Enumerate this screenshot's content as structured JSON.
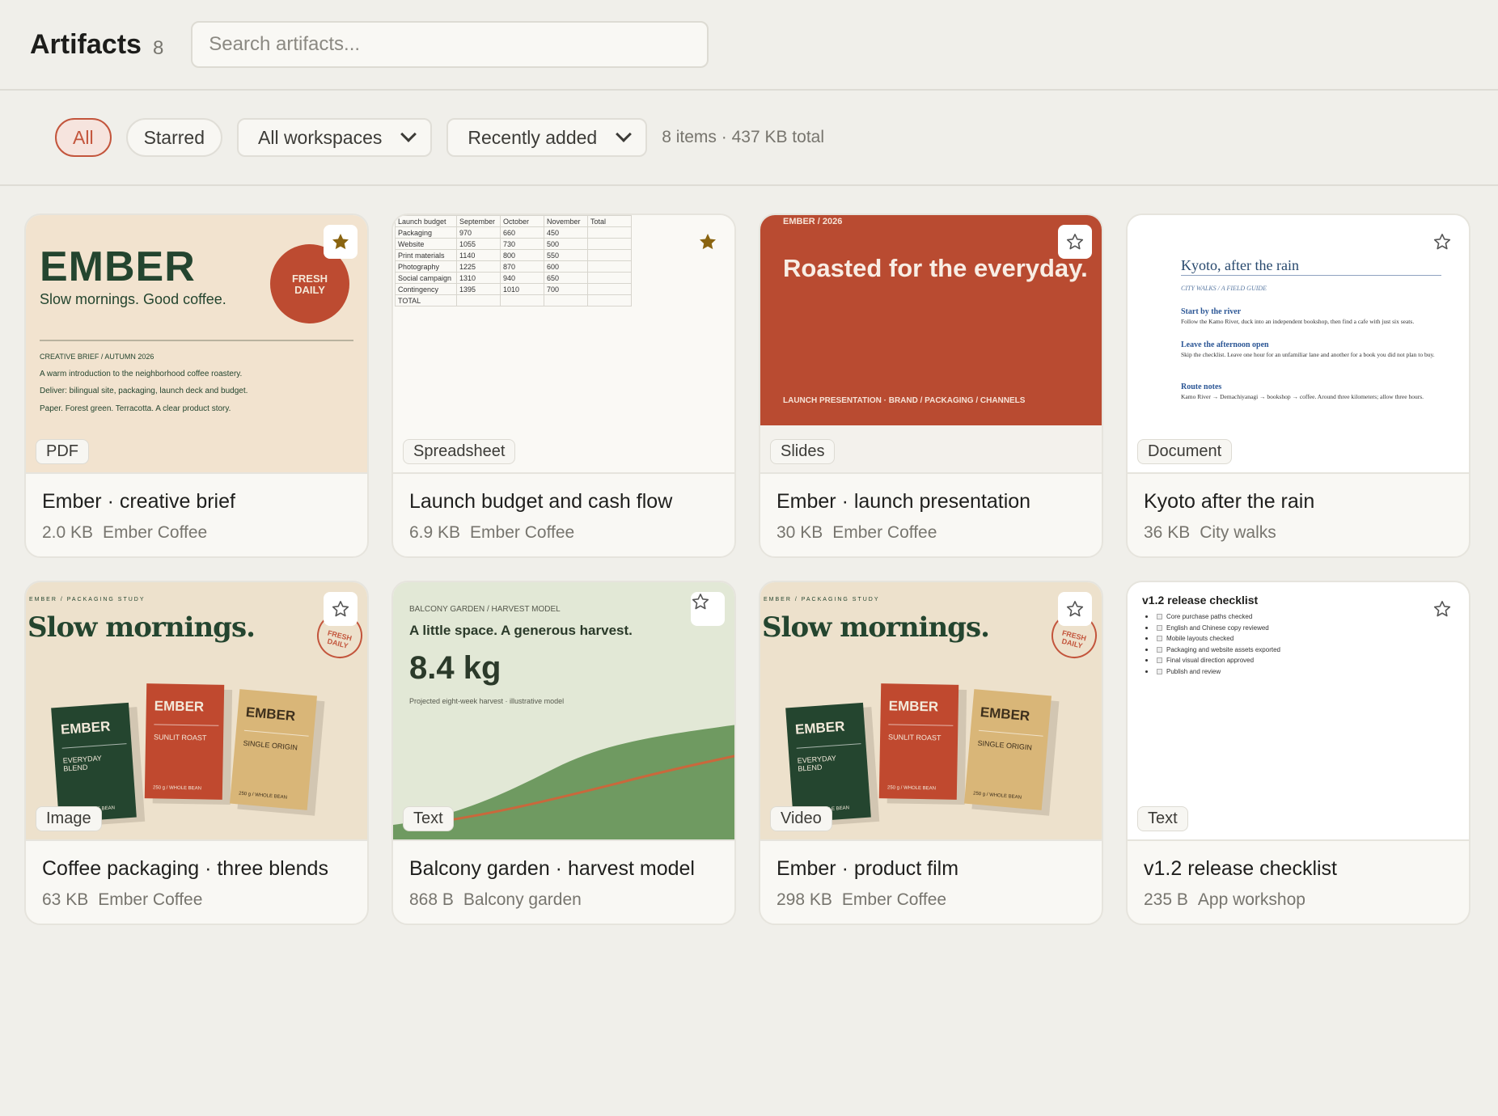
{
  "header": {
    "title": "Artifacts",
    "count": "8",
    "search_placeholder": "Search artifacts..."
  },
  "filters": {
    "all_label": "All",
    "starred_label": "Starred",
    "workspace_label": "All workspaces",
    "sort_label": "Recently added",
    "summary": "8 items · 437 KB total"
  },
  "colors": {
    "accent": "#c3553c",
    "star_filled": "#8a6410"
  },
  "cards": [
    {
      "title": "Ember · creative brief",
      "size": "2.0 KB",
      "workspace": "Ember Coffee",
      "type": "PDF",
      "starred": true,
      "thumb": {
        "brand": "EMBER",
        "tagline": "Slow mornings. Good coffee.",
        "badge_line1": "FRESH",
        "badge_line2": "DAILY",
        "line1": "CREATIVE BRIEF / AUTUMN 2026",
        "line2": "A warm introduction to the neighborhood coffee roastery.",
        "line3": "Deliver: bilingual site, packaging, launch deck and budget.",
        "line4": "Paper. Forest green. Terracotta. A clear product story."
      }
    },
    {
      "title": "Launch budget and cash flow",
      "size": "6.9 KB",
      "workspace": "Ember Coffee",
      "type": "Spreadsheet",
      "starred": true,
      "thumb": {
        "headers": [
          "Launch budget",
          "September",
          "October",
          "November",
          "Total"
        ],
        "rows": [
          [
            "Packaging",
            "970",
            "660",
            "450",
            ""
          ],
          [
            "Website",
            "1055",
            "730",
            "500",
            ""
          ],
          [
            "Print materials",
            "1140",
            "800",
            "550",
            ""
          ],
          [
            "Photography",
            "1225",
            "870",
            "600",
            ""
          ],
          [
            "Social campaign",
            "1310",
            "940",
            "650",
            ""
          ],
          [
            "Contingency",
            "1395",
            "1010",
            "700",
            ""
          ],
          [
            "TOTAL",
            "",
            "",
            "",
            ""
          ]
        ]
      }
    },
    {
      "title": "Ember · launch presentation",
      "size": "30 KB",
      "workspace": "Ember Coffee",
      "type": "Slides",
      "starred": false,
      "thumb": {
        "label": "EMBER / 2026",
        "headline": "Roasted for the everyday.",
        "footer": "LAUNCH PRESENTATION · BRAND / PACKAGING / CHANNELS"
      }
    },
    {
      "title": "Kyoto after the rain",
      "size": "36 KB",
      "workspace": "City walks",
      "type": "Document",
      "starred": false,
      "thumb": {
        "title": "Kyoto, after the rain",
        "kicker": "CITY WALKS / A FIELD GUIDE",
        "h1": "Start by the river",
        "p1": "Follow the Kamo River, duck into an independent bookshop, then find a cafe with just six seats.",
        "h2": "Leave the afternoon open",
        "p2": "Skip the checklist. Leave one hour for an unfamiliar lane and another for a book you did not plan to buy.",
        "h3": "Route notes",
        "p3": "Kamo River → Demachiyanagi → bookshop → coffee. Around three kilometers; allow three hours."
      }
    },
    {
      "title": "Coffee packaging · three blends",
      "size": "63 KB",
      "workspace": "Ember Coffee",
      "type": "Image",
      "starred": false,
      "thumb": {
        "kicker": "EMBER / PACKAGING STUDY",
        "headline": "Slow mornings.",
        "stamp": "FRESH DAILY",
        "bag1_name": "EMBER",
        "bag1_sub": "EVERYDAY BLEND",
        "bag1_foot": "250 g / WHOLE BEAN",
        "bag2_name": "EMBER",
        "bag2_sub": "SUNLIT ROAST",
        "bag2_foot": "250 g / WHOLE BEAN",
        "bag3_name": "EMBER",
        "bag3_sub": "SINGLE ORIGIN",
        "bag3_foot": "250 g / WHOLE BEAN"
      }
    },
    {
      "title": "Balcony garden · harvest model",
      "size": "868 B",
      "workspace": "Balcony garden",
      "type": "Text",
      "starred": false,
      "thumb": {
        "kicker": "BALCONY GARDEN / HARVEST MODEL",
        "headline": "A little space. A generous harvest.",
        "value": "8.4 kg",
        "caption": "Projected eight-week harvest · illustrative model"
      }
    },
    {
      "title": "Ember · product film",
      "size": "298 KB",
      "workspace": "Ember Coffee",
      "type": "Video",
      "starred": false,
      "thumb": {
        "kicker": "EMBER / PACKAGING STUDY",
        "headline": "Slow mornings.",
        "stamp": "FRESH DAILY",
        "bag1_name": "EMBER",
        "bag1_sub": "EVERYDAY BLEND",
        "bag1_foot": "250 g / WHOLE BEAN",
        "bag2_name": "EMBER",
        "bag2_sub": "SUNLIT ROAST",
        "bag2_foot": "250 g / WHOLE BEAN",
        "bag3_name": "EMBER",
        "bag3_sub": "SINGLE ORIGIN",
        "bag3_foot": "250 g / WHOLE BEAN"
      }
    },
    {
      "title": "v1.2 release checklist",
      "size": "235 B",
      "workspace": "App workshop",
      "type": "Text",
      "starred": false,
      "thumb": {
        "title": "v1.2 release checklist",
        "items": [
          "Core purchase paths checked",
          "English and Chinese copy reviewed",
          "Mobile layouts checked",
          "Packaging and website assets exported",
          "Final visual direction approved",
          "Publish and review"
        ]
      }
    }
  ]
}
